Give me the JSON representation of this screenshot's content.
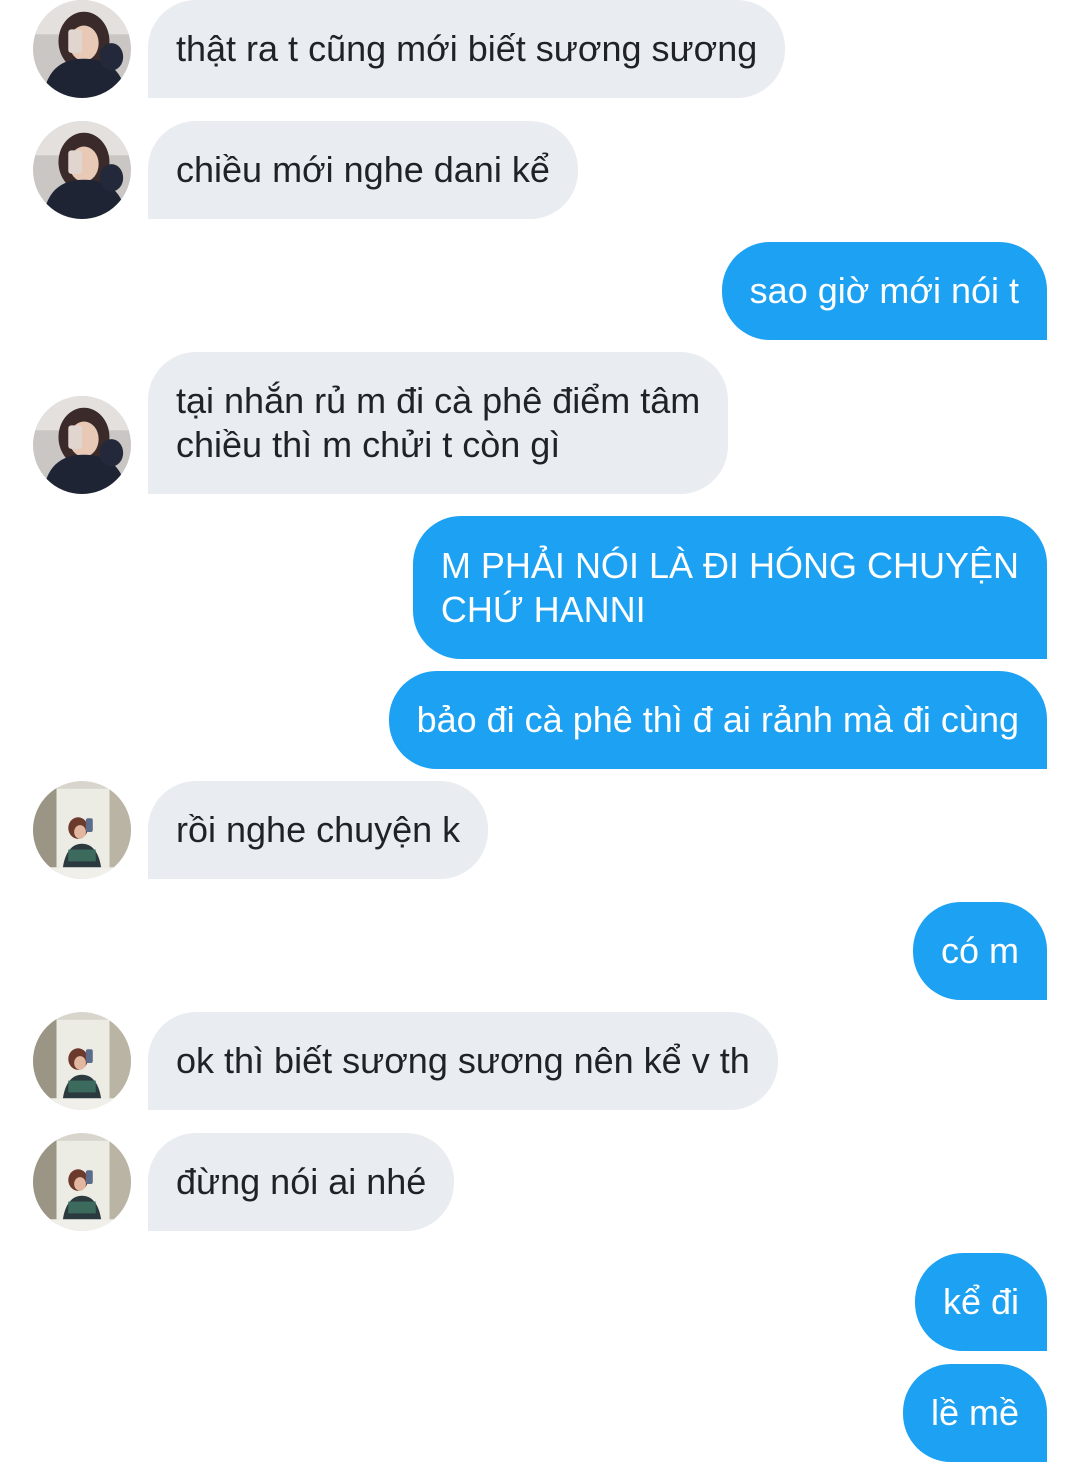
{
  "conversation": {
    "messages": [
      {
        "text": "thật ra t cũng mới biết sương sương"
      },
      {
        "text": "chiều mới nghe dani kể"
      },
      {
        "text": "sao giờ mới nói t"
      },
      {
        "text": "tại nhắn rủ m đi cà phê điểm tâm\nchiều thì m chửi t còn gì"
      },
      {
        "text": "M PHẢI NÓI LÀ ĐI HÓNG CHUYỆN\nCHỨ HANNI"
      },
      {
        "text": "bảo đi cà phê thì đ ai rảnh mà đi cùng"
      },
      {
        "text": "rồi nghe chuyện k"
      },
      {
        "text": "có m"
      },
      {
        "text": "ok thì biết sương sương nên kể v th"
      },
      {
        "text": "đừng nói ai nhé"
      },
      {
        "text": "kể đi"
      },
      {
        "text": "lề mề"
      }
    ]
  },
  "colors": {
    "incoming_bubble": "#e9ecf0",
    "outgoing_bubble": "#1da1f2",
    "incoming_text": "#1f2328",
    "outgoing_text": "#ffffff"
  }
}
